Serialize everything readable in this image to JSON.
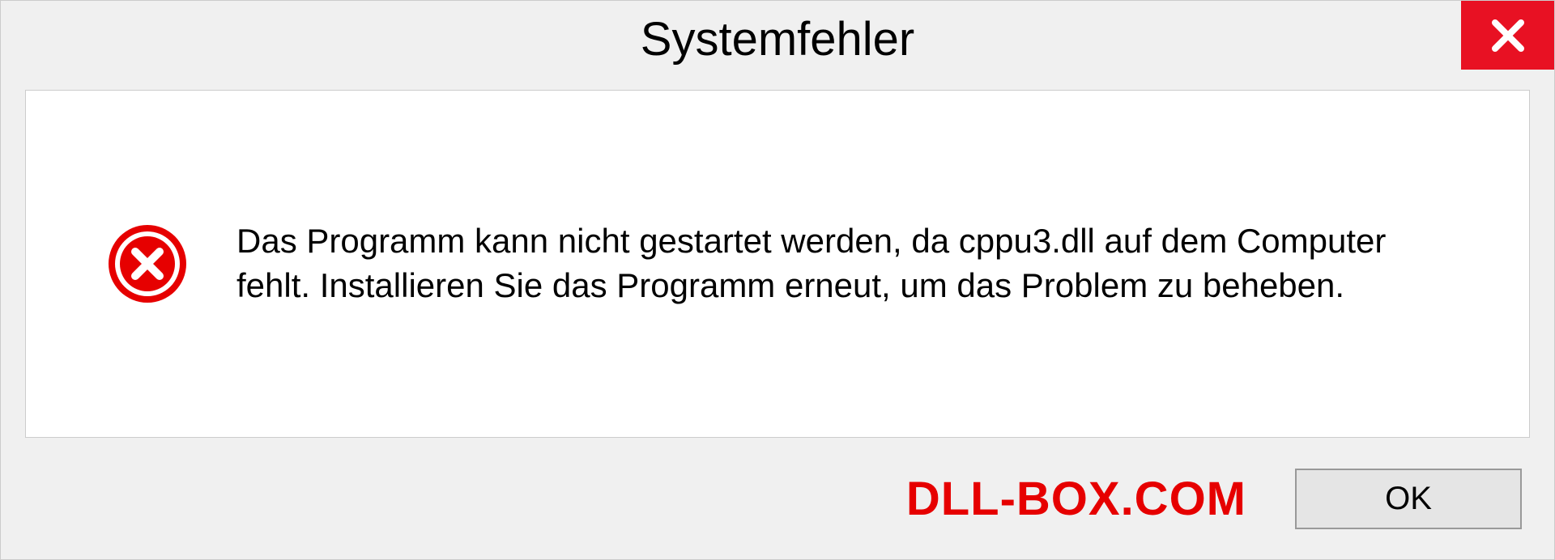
{
  "dialog": {
    "title": "Systemfehler",
    "message": "Das Programm kann nicht gestartet werden, da cppu3.dll auf dem Computer fehlt. Installieren Sie das Programm erneut, um das Problem zu beheben.",
    "ok_label": "OK"
  },
  "watermark": "DLL-BOX.COM"
}
